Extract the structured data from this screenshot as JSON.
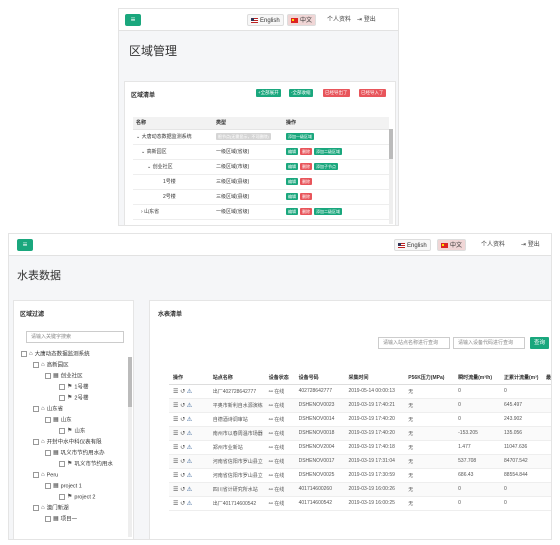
{
  "shot1": {
    "lang_en": "English",
    "lang_zh": "中文",
    "profile": "个人资料",
    "logout": "登出",
    "page_title": "区域管理",
    "panel_title": "区域清单",
    "btn_expand_all": "+全部展开",
    "btn_collapse_all": "-全部收缩",
    "btn_export_region": "已经导出了",
    "btn_import_region": "已经导入了",
    "columns": [
      "名称",
      "类型",
      "操作"
    ],
    "rows": [
      {
        "name": "大唐动态数据监测系统",
        "type": "根节点(无需显示，不可删除)",
        "actions": [
          "添加一级区域"
        ]
      },
      {
        "name": "高新园区",
        "type": "一级区域(省级)",
        "actions": [
          "编辑",
          "删除",
          "添加二级区域"
        ]
      },
      {
        "name": "创业社区",
        "type": "二级区域(市级)",
        "actions": [
          "编辑",
          "删除",
          "添加子节点"
        ]
      },
      {
        "name": "1号楼",
        "type": "三级区域(县级)",
        "actions": [
          "编辑",
          "删除"
        ]
      },
      {
        "name": "2号楼",
        "type": "三级区域(县级)",
        "actions": [
          "编辑",
          "删除"
        ]
      },
      {
        "name": "山东省",
        "type": "一级区域(省级)",
        "actions": [
          "编辑",
          "删除",
          "添加二级区域"
        ]
      }
    ]
  },
  "shot2": {
    "lang_en": "English",
    "lang_zh": "中文",
    "profile": "个人资料",
    "logout": "登出",
    "page_title": "水表数据",
    "filter_title": "区域过滤",
    "filter_placeholder": "请输入关键字搜索",
    "tree": [
      {
        "label": "大唐动态数据监测系统",
        "level": 0,
        "icon": "home-icon"
      },
      {
        "label": "高新园区",
        "level": 1,
        "icon": "home-icon"
      },
      {
        "label": "创业社区",
        "level": 2,
        "icon": "grid-icon"
      },
      {
        "label": "1号楼",
        "level": 3,
        "icon": "flag-icon"
      },
      {
        "label": "2号楼",
        "level": 3,
        "icon": "flag-icon"
      },
      {
        "label": "山东省",
        "level": 1,
        "icon": "home-icon"
      },
      {
        "label": "山东",
        "level": 2,
        "icon": "grid-icon"
      },
      {
        "label": "山东",
        "level": 3,
        "icon": "flag-icon"
      },
      {
        "label": "开封中水中科仪表有限",
        "level": 1,
        "icon": "home-icon"
      },
      {
        "label": "巩义市节约用水办",
        "level": 2,
        "icon": "grid-icon"
      },
      {
        "label": "巩义市节约用水",
        "level": 3,
        "icon": "flag-icon"
      },
      {
        "label": "Peru",
        "level": 1,
        "icon": "home-icon"
      },
      {
        "label": "project 1",
        "level": 2,
        "icon": "grid-icon"
      },
      {
        "label": "project 2",
        "level": 3,
        "icon": "flag-icon"
      },
      {
        "label": "澳门新湖",
        "level": 1,
        "icon": "home-icon"
      },
      {
        "label": "项目一",
        "level": 2,
        "icon": "grid-icon"
      }
    ],
    "list_title": "水表清单",
    "site_search_placeholder": "请输入站点名称进行查询",
    "device_search_placeholder": "请输入设备代码进行查询",
    "query_button": "查询",
    "columns": [
      "操作",
      "站点名称",
      "设备状态",
      "设备号码",
      "采集时间",
      "P56K压力(MPa)",
      "瞬时流量(m³/h)",
      "正累计流量(m³)",
      "最"
    ],
    "rows": [
      {
        "site": "出厂402728642777",
        "status": "在线",
        "device": "402728642777",
        "time": "2019-05-14 00:00:13",
        "pressure": "无",
        "flow": "0",
        "total": "0"
      },
      {
        "site": "平奥市新利自水源演练",
        "status": "在线",
        "device": "DSHENOV0023",
        "time": "2019-03-19 17:40:21",
        "pressure": "无",
        "flow": "0",
        "total": "645.497"
      },
      {
        "site": "自德酒诗调审站",
        "status": "在线",
        "device": "DSHENOV0014",
        "time": "2019-03-19 17:40:20",
        "pressure": "无",
        "flow": "0",
        "total": "243.902"
      },
      {
        "site": "南州市以春周温市场器",
        "status": "在线",
        "device": "DSHENOV0018",
        "time": "2019-03-19 17:40:20",
        "pressure": "无",
        "flow": "-153.205",
        "total": "135.056"
      },
      {
        "site": "郑州市业新站",
        "status": "在线",
        "device": "DSHENOV2004",
        "time": "2019-03-19 17:40:18",
        "pressure": "无",
        "flow": "1.477",
        "total": "11047.636"
      },
      {
        "site": "河南省信阳市罗山县立",
        "status": "在线",
        "device": "DSHENOV0017",
        "time": "2019-03-19 17:31:04",
        "pressure": "无",
        "flow": "537.708",
        "total": "84707.542"
      },
      {
        "site": "河南省信阳市罗山县立",
        "status": "在线",
        "device": "DSHENOV0025",
        "time": "2019-03-19 17:30:59",
        "pressure": "无",
        "flow": "686.43",
        "total": "88554.844"
      },
      {
        "site": "四川省计研究所水站",
        "status": "在线",
        "device": "401714600260",
        "time": "2019-03-19 16:00:26",
        "pressure": "无",
        "flow": "0",
        "total": "0"
      },
      {
        "site": "出厂401714600542",
        "status": "在线",
        "device": "401714600542",
        "time": "2019-03-19 16:00:25",
        "pressure": "无",
        "flow": "0",
        "total": "0"
      }
    ]
  }
}
